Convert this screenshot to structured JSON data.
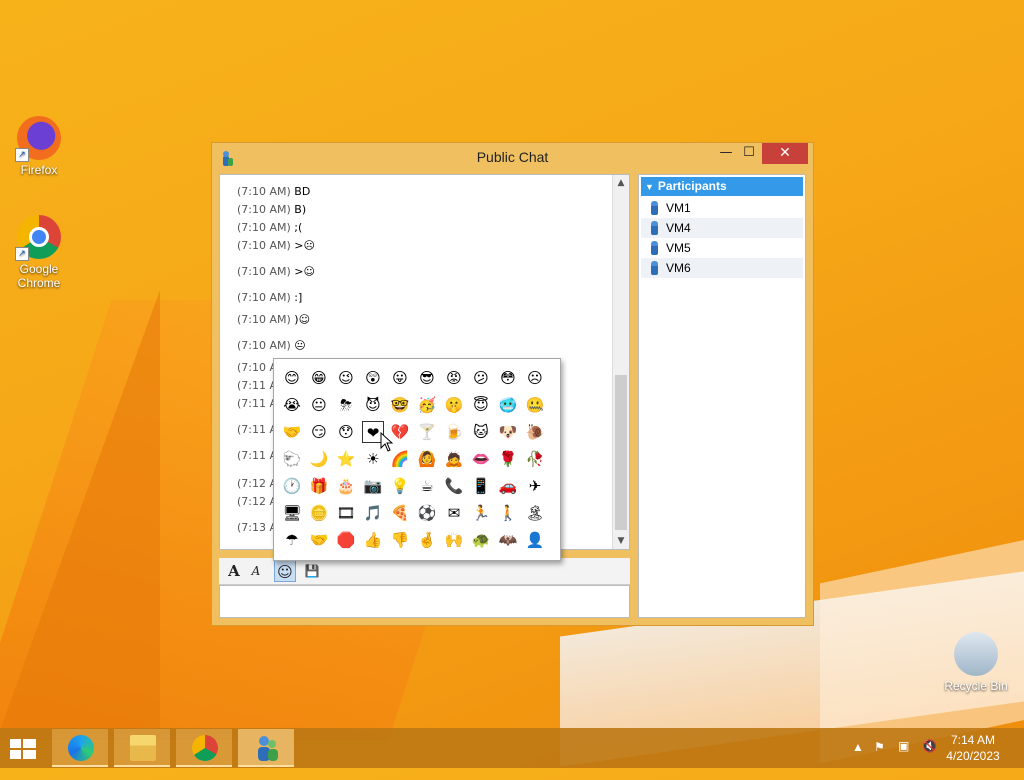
{
  "desktop": {
    "icons": [
      {
        "label": "Firefox"
      },
      {
        "label": "Google Chrome"
      },
      {
        "label": "Recycle Bin"
      }
    ]
  },
  "window": {
    "title": "Public Chat",
    "controls": {
      "minimize": "—",
      "maximize": "☐",
      "close": "✕"
    },
    "messages": [
      {
        "time": "(7:10 AM)",
        "text": "BD"
      },
      {
        "time": "(7:10 AM)",
        "text": "B)"
      },
      {
        "time": "(7:10 AM)",
        "text": ";("
      },
      {
        "time": "(7:10 AM)",
        "text": ">☹"
      },
      {
        "time": "(7:10 AM)",
        "text": ">☺"
      },
      {
        "time": "(7:10 AM)",
        "text": ":]"
      },
      {
        "time": "(7:10 AM)",
        "text": ")☺"
      },
      {
        "time": "(7:10 AM)",
        "text": "😐"
      },
      {
        "time": "(7:10 AM)",
        "text": ""
      },
      {
        "time": "(7:11 AM)",
        "text": ""
      },
      {
        "time": "(7:11 AM)",
        "text": ""
      },
      {
        "time": "(7:11 AM)",
        "text": ""
      },
      {
        "time": "(7:11 AM)",
        "text": ""
      },
      {
        "time": "(7:12 AM)",
        "text": ""
      },
      {
        "time": "(7:12 AM)",
        "text": ""
      },
      {
        "time": "(7:13 AM)",
        "text": ""
      }
    ],
    "participants_header": "Participants",
    "participants": [
      "VM1",
      "VM4",
      "VM5",
      "VM6"
    ],
    "emoticons": [
      [
        "😊",
        "😁",
        "😉",
        "😲",
        "😛",
        "😎",
        "😡",
        "😕",
        "😳",
        "☹"
      ],
      [
        "😭",
        "😐",
        "⛈",
        "😈",
        "🤓",
        "🥳",
        "🤫",
        "😇",
        "🥶",
        "🤐"
      ],
      [
        "🤝",
        "😏",
        "😯",
        "❤",
        "💔",
        "🍸",
        "🍺",
        "🐱",
        "🐶",
        "🐌"
      ],
      [
        "🐑",
        "🌙",
        "⭐",
        "☀",
        "🌈",
        "🙆",
        "🙇",
        "👄",
        "🌹",
        "🥀"
      ],
      [
        "🕐",
        "🎁",
        "🎂",
        "📷",
        "💡",
        "☕",
        "📞",
        "📱",
        "🚗",
        "✈"
      ],
      [
        "🖥",
        "🪙",
        "🎞",
        "🎵",
        "🍕",
        "⚽",
        "✉",
        "🏃",
        "🚶",
        "🏝"
      ],
      [
        "☂",
        "🤝",
        "🛑",
        "👍",
        "👎",
        "🤞",
        "🙌",
        "🐢",
        "🦇",
        "👤"
      ]
    ],
    "format_bar": {
      "font": "A",
      "color": "A",
      "emoticon": "☺",
      "save": "💾"
    }
  },
  "taskbar": {
    "time": "7:14 AM",
    "date": "4/20/2023",
    "tray_arrow": "▲"
  },
  "colors": {
    "participants_header": "#3399e8",
    "close_button": "#c7403a"
  }
}
